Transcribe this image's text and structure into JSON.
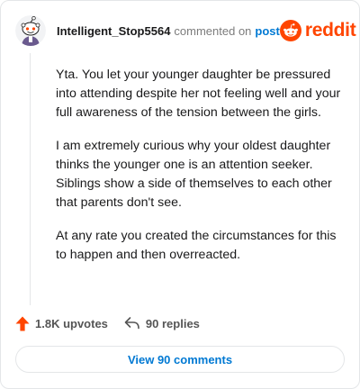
{
  "header": {
    "username": "Intelligent_Stop5564",
    "action_text": "commented on",
    "post_link": "post",
    "brand": "reddit"
  },
  "comment": {
    "paragraphs": [
      "Yta. You let your younger daughter be pressured into attending despite her not feeling well and your full awareness of the tension between the girls.",
      "I am extremely curious why your oldest daughter thinks the younger one is an attention seeker. Siblings show a side of themselves to each other that parents don't see.",
      "At any rate you created the circumstances for this to happen and then overreacted."
    ]
  },
  "actions": {
    "upvotes": "1.8K upvotes",
    "replies": "90 replies"
  },
  "footer": {
    "view_button": "View 90 comments"
  },
  "icons": {
    "avatar": "reddit-snoo-avatar",
    "brand": "reddit-logo-icon",
    "upvote": "upvote-arrow-icon",
    "reply": "reply-arrow-icon"
  },
  "colors": {
    "brand": "#ff4500",
    "link": "#0079d3",
    "muted": "#7c7c7c"
  }
}
